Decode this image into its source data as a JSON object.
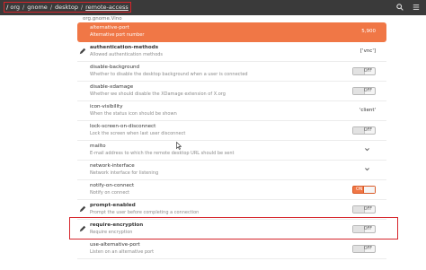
{
  "header": {
    "breadcrumb": {
      "root": "/",
      "parts": [
        "org",
        "gnome",
        "desktop",
        "remote-access"
      ],
      "separator": "/"
    },
    "icons": {
      "search": "search-icon",
      "menu": "hamburger-menu-icon"
    }
  },
  "schema_title": "org.gnome.Vino",
  "rows": [
    {
      "name": "alternative-port",
      "desc": "Alternative port number",
      "value": "5,900",
      "selected": true,
      "type": "text"
    },
    {
      "name": "authentication-methods",
      "desc": "Allowed authentication methods",
      "value": "['vnc']",
      "type": "text",
      "pencil": true
    },
    {
      "name": "disable-background",
      "desc": "Whether to disable the desktop background when a user is connected",
      "toggle": "OFF",
      "type": "toggle"
    },
    {
      "name": "disable-xdamage",
      "desc": "Whether we should disable the XDamage extension of X.org",
      "toggle": "OFF",
      "type": "toggle"
    },
    {
      "name": "icon-visibility",
      "desc": "When the status icon should be shown",
      "value": "'client'",
      "type": "text"
    },
    {
      "name": "lock-screen-on-disconnect",
      "desc": "Lock the screen when last user disconnect",
      "toggle": "OFF",
      "type": "toggle"
    },
    {
      "name": "mailto",
      "desc": "E-mail address to which the remote desktop URL should be sent",
      "type": "chevron"
    },
    {
      "name": "network-interface",
      "desc": "Network interface for listening",
      "type": "chevron"
    },
    {
      "name": "notify-on-connect",
      "desc": "Notify on connect",
      "toggle": "ON",
      "type": "toggle"
    },
    {
      "name": "prompt-enabled",
      "desc": "Prompt the user before completing a connection",
      "toggle": "OFF",
      "type": "toggle",
      "pencil": true,
      "bold": true
    },
    {
      "name": "require-encryption",
      "desc": "Require encryption",
      "toggle": "OFF",
      "type": "toggle",
      "pencil": true,
      "bold": true,
      "highlighted": true
    },
    {
      "name": "use-alternative-port",
      "desc": "Listen on an alternative port",
      "toggle": "OFF",
      "type": "toggle"
    }
  ]
}
